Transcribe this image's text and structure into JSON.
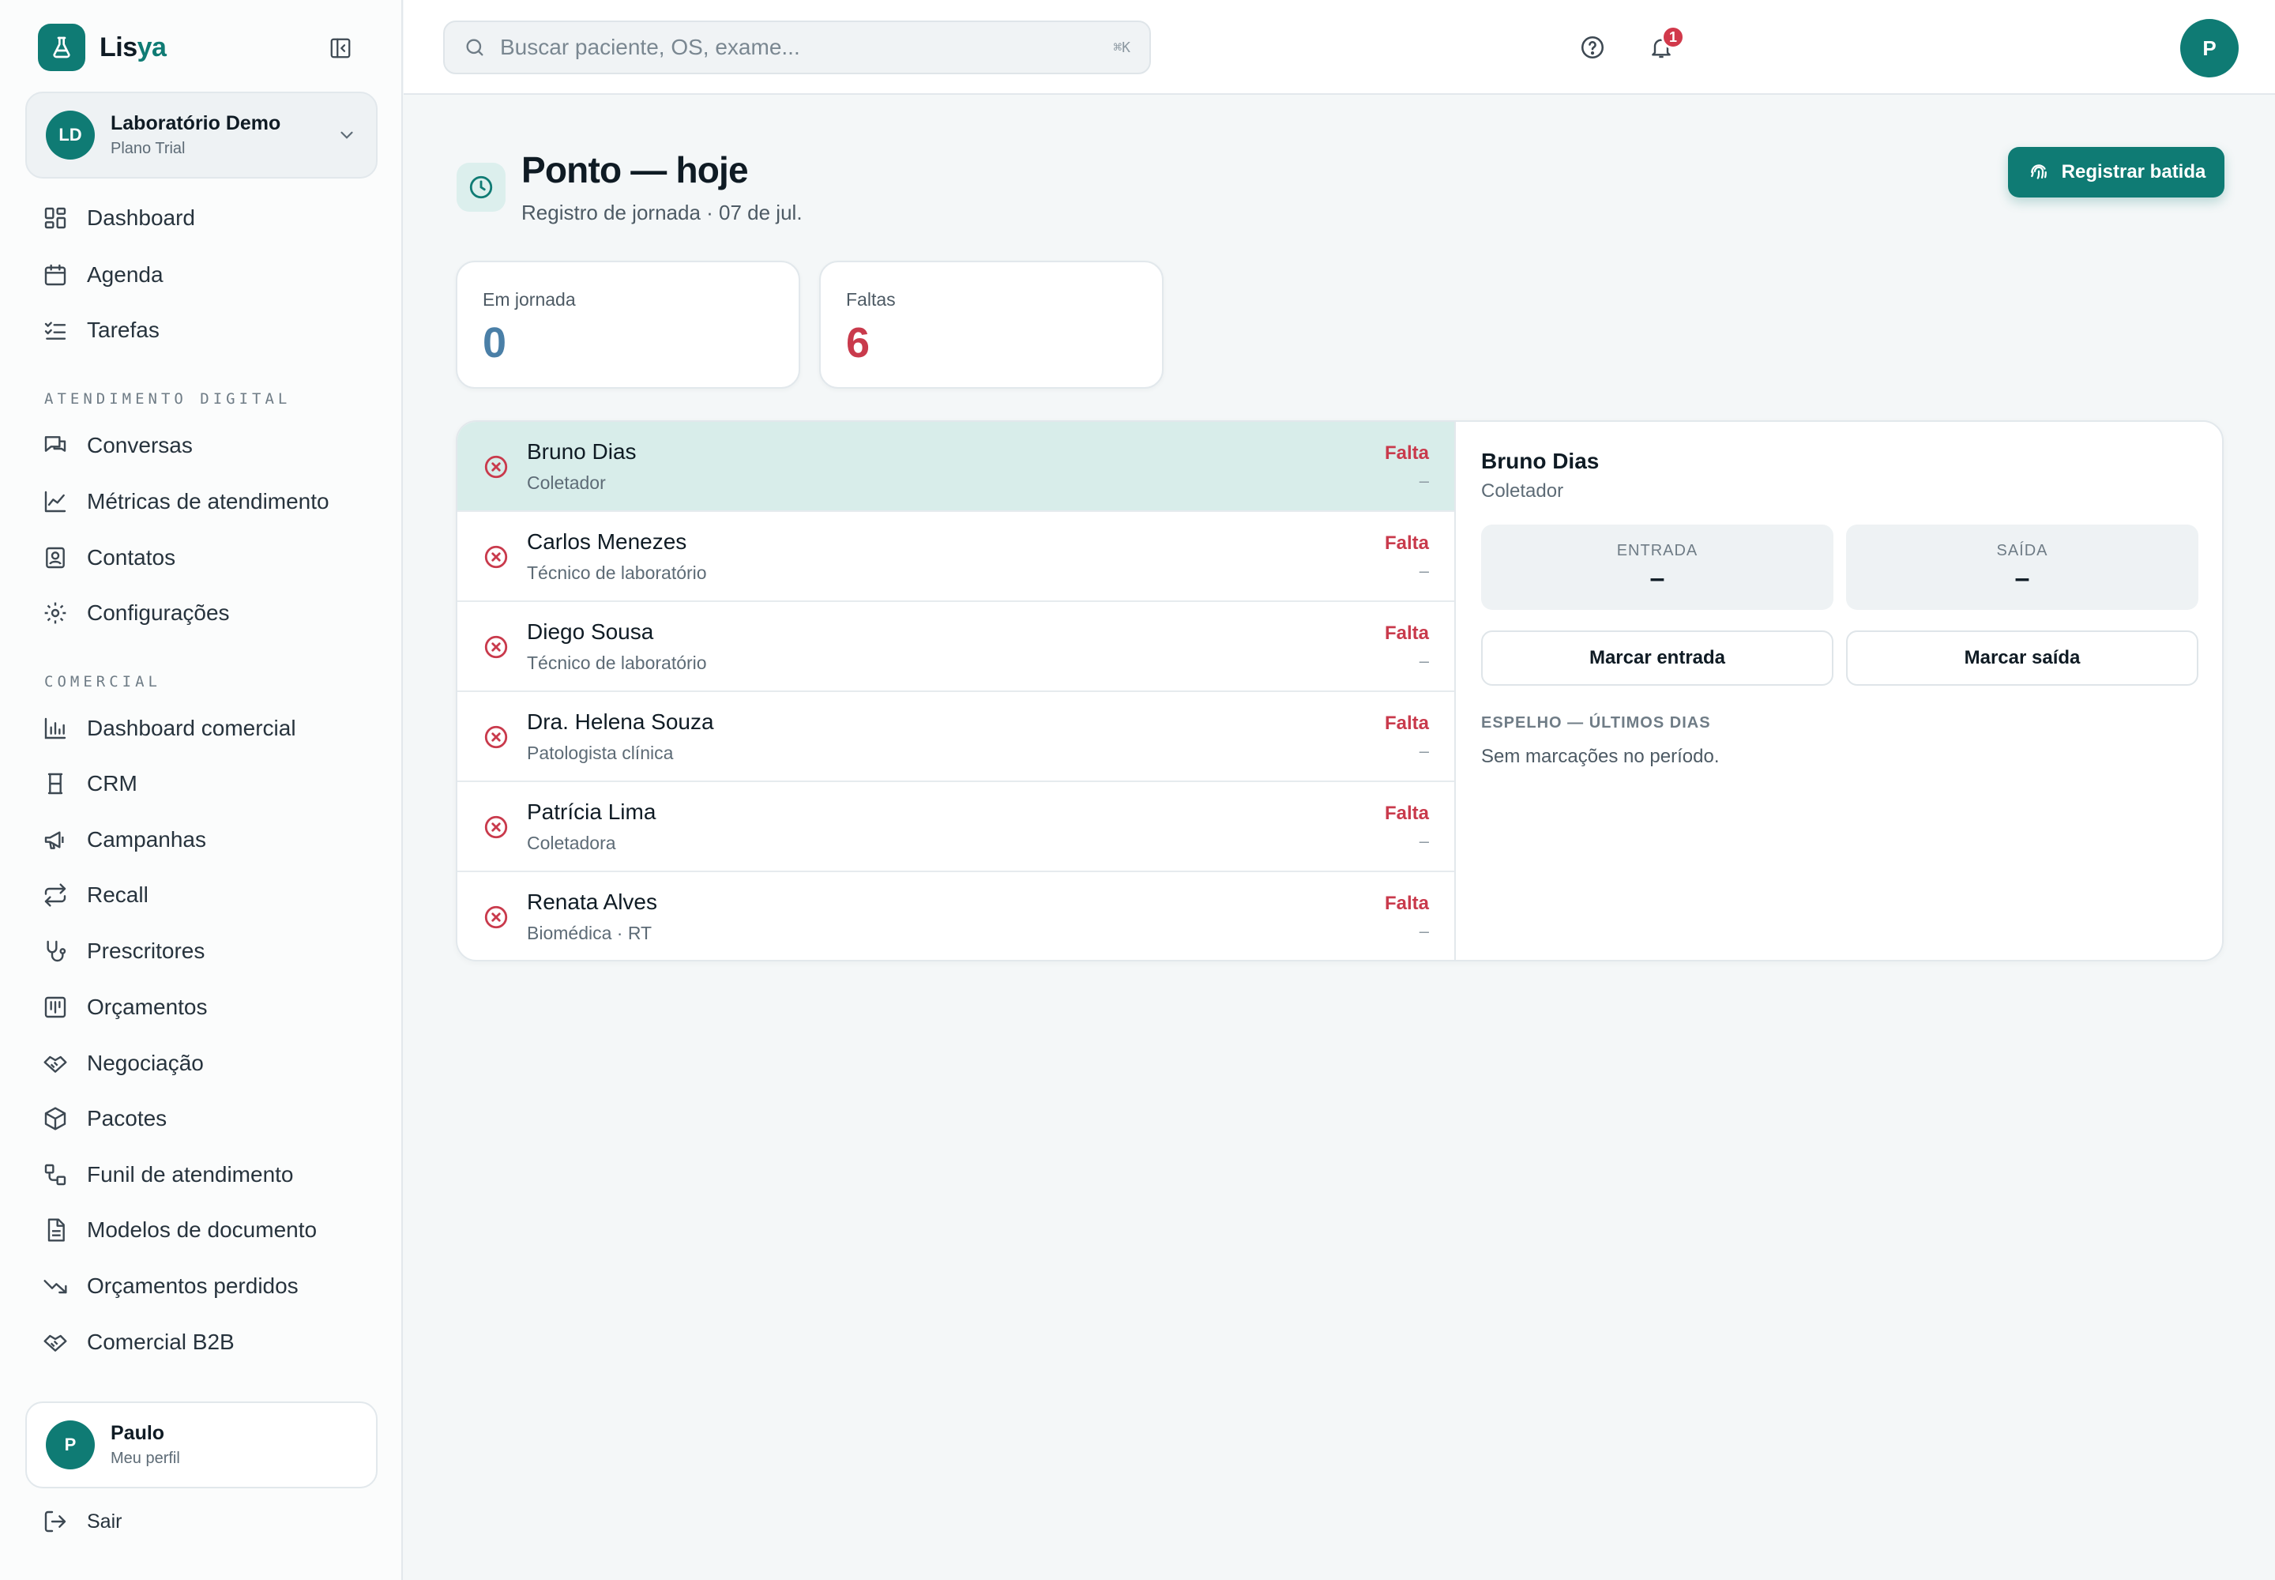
{
  "brand": {
    "name_prefix": "Lis",
    "name_accent": "ya"
  },
  "org": {
    "initials": "LD",
    "name": "Laboratório Demo",
    "plan": "Plano Trial"
  },
  "nav": {
    "main": [
      {
        "label": "Dashboard",
        "icon": "dashboard-icon"
      },
      {
        "label": "Agenda",
        "icon": "calendar-icon"
      },
      {
        "label": "Tarefas",
        "icon": "tasks-icon"
      }
    ],
    "digital_title": "ATENDIMENTO DIGITAL",
    "digital": [
      {
        "label": "Conversas",
        "icon": "chat-icon"
      },
      {
        "label": "Métricas de atendimento",
        "icon": "line-chart-icon"
      },
      {
        "label": "Contatos",
        "icon": "contacts-icon"
      },
      {
        "label": "Configurações",
        "icon": "gear-icon"
      }
    ],
    "commercial_title": "COMERCIAL",
    "commercial": [
      {
        "label": "Dashboard comercial",
        "icon": "bar-chart-icon"
      },
      {
        "label": "CRM",
        "icon": "crm-icon"
      },
      {
        "label": "Campanhas",
        "icon": "megaphone-icon"
      },
      {
        "label": "Recall",
        "icon": "recall-icon"
      },
      {
        "label": "Prescritores",
        "icon": "stethoscope-icon"
      },
      {
        "label": "Orçamentos",
        "icon": "budget-icon"
      },
      {
        "label": "Negociação",
        "icon": "handshake-icon"
      },
      {
        "label": "Pacotes",
        "icon": "package-icon"
      },
      {
        "label": "Funil de atendimento",
        "icon": "funnel-icon"
      },
      {
        "label": "Modelos de documento",
        "icon": "document-icon"
      },
      {
        "label": "Orçamentos perdidos",
        "icon": "trending-down-icon"
      },
      {
        "label": "Comercial B2B",
        "icon": "handshake-icon"
      }
    ]
  },
  "profile": {
    "initial": "P",
    "name": "Paulo",
    "sub": "Meu perfil"
  },
  "logout_label": "Sair",
  "search": {
    "placeholder": "Buscar paciente, OS, exame...",
    "shortcut": "⌘K"
  },
  "topbar": {
    "notifications_count": "1",
    "user_initial": "P"
  },
  "page": {
    "title": "Ponto — hoje",
    "subtitle": "Registro de jornada · 07 de jul.",
    "action_label": "Registrar batida"
  },
  "stats": [
    {
      "label": "Em jornada",
      "value": "0",
      "color": "#4a7fa7"
    },
    {
      "label": "Faltas",
      "value": "6",
      "color": "#c93a4c"
    }
  ],
  "employees": [
    {
      "name": "Bruno Dias",
      "role": "Coletador",
      "status": "Falta",
      "time": "–"
    },
    {
      "name": "Carlos Menezes",
      "role": "Técnico de laboratório",
      "status": "Falta",
      "time": "–"
    },
    {
      "name": "Diego Sousa",
      "role": "Técnico de laboratório",
      "status": "Falta",
      "time": "–"
    },
    {
      "name": "Dra. Helena Souza",
      "role": "Patologista clínica",
      "status": "Falta",
      "time": "–"
    },
    {
      "name": "Patrícia Lima",
      "role": "Coletadora",
      "status": "Falta",
      "time": "–"
    },
    {
      "name": "Renata Alves",
      "role": "Biomédica · RT",
      "status": "Falta",
      "time": "–"
    }
  ],
  "detail": {
    "name": "Bruno Dias",
    "role": "Coletador",
    "entry_label": "ENTRADA",
    "entry_value": "–",
    "exit_label": "SAÍDA",
    "exit_value": "–",
    "mark_entry_label": "Marcar entrada",
    "mark_exit_label": "Marcar saída",
    "mirror_title": "ESPELHO — ÚLTIMOS DIAS",
    "mirror_empty": "Sem marcações no período."
  },
  "colors": {
    "brand": "#0f7b74",
    "danger": "#c93a4c",
    "selected_row": "#d8edea"
  }
}
